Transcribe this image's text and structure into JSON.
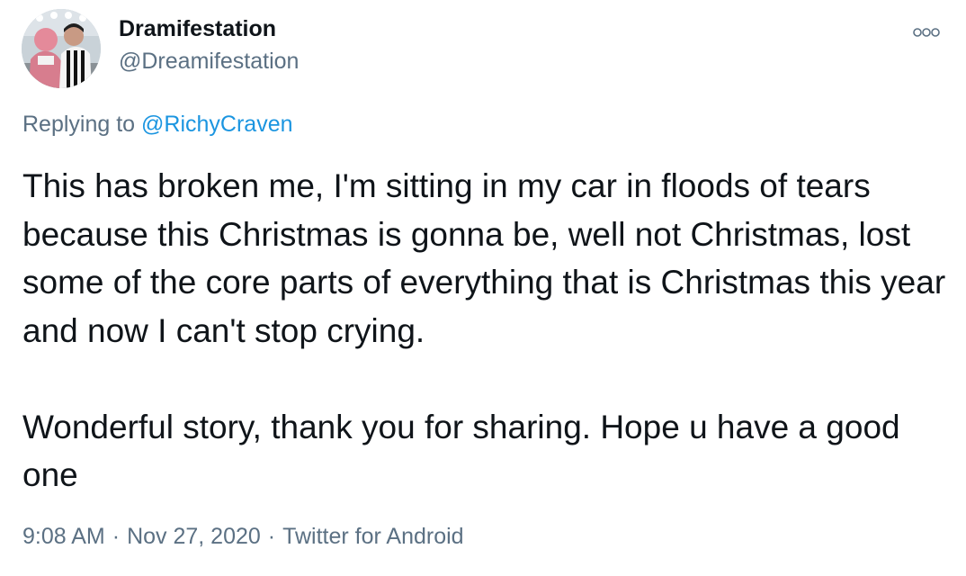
{
  "user": {
    "display_name": "Dramifestation",
    "handle": "@Dreamifestation"
  },
  "reply": {
    "prefix": "Replying to ",
    "mention": "@RichyCraven"
  },
  "tweet": {
    "paragraphs": [
      "This has broken me, I'm sitting in my car in floods of tears because this Christmas is gonna be, well not Christmas, lost some of the core parts of everything that is Christmas this year and now I can't stop crying.",
      "Wonderful story, thank you for sharing. Hope u have a good one"
    ]
  },
  "meta": {
    "time": "9:08 AM",
    "date": "Nov 27, 2020",
    "source": "Twitter for Android",
    "separator": "·"
  },
  "icons": {
    "more": "more-options-icon"
  },
  "colors": {
    "text": "#0f1419",
    "secondary": "#5b7083",
    "link": "#1b95e0"
  }
}
